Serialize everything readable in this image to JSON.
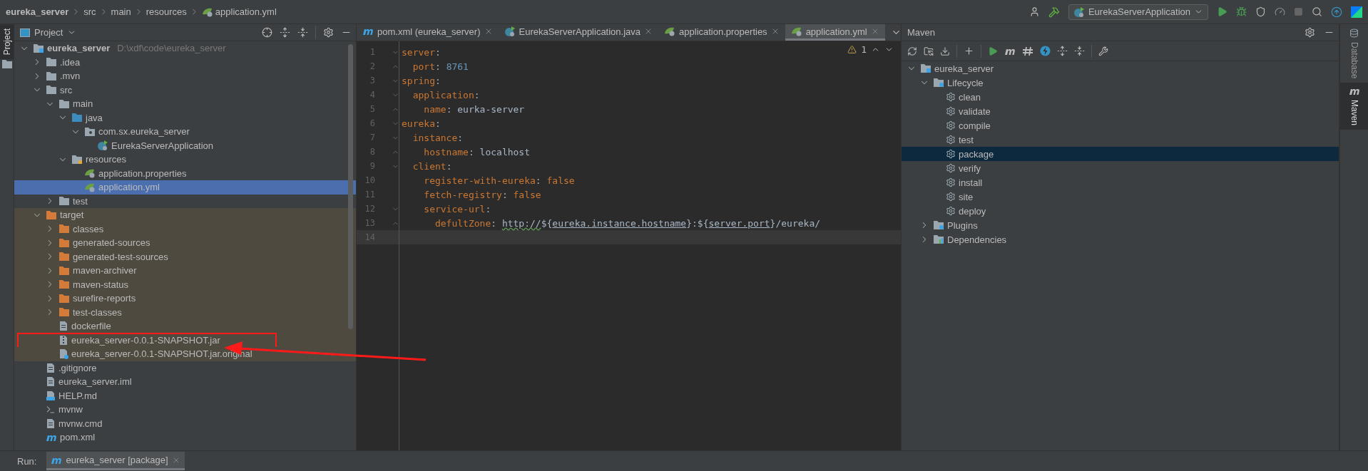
{
  "breadcrumb": [
    {
      "text": "eureka_server",
      "kind": "project"
    },
    {
      "text": "src",
      "kind": "plain"
    },
    {
      "text": "main",
      "kind": "plain"
    },
    {
      "text": "resources",
      "kind": "plain"
    },
    {
      "text": "application.yml",
      "kind": "config"
    }
  ],
  "run_config": "EurekaServerApplication",
  "left_strip": [
    {
      "label": "Project",
      "selected": true
    }
  ],
  "project_panel": {
    "title": "Project",
    "tree": [
      {
        "name": "eureka_server",
        "path": "D:\\xdf\\code\\eureka_server",
        "kind": "module",
        "expanded": true,
        "selected": false,
        "children": [
          {
            "name": ".idea",
            "kind": "folder",
            "expanded": false,
            "selected": false,
            "excluded": false
          },
          {
            "name": ".mvn",
            "kind": "folder",
            "expanded": false,
            "selected": false,
            "excluded": false
          },
          {
            "name": "src",
            "kind": "folder",
            "expanded": true,
            "selected": false,
            "excluded": false,
            "children": [
              {
                "name": "main",
                "kind": "folder",
                "expanded": true,
                "selected": false,
                "children": [
                  {
                    "name": "java",
                    "kind": "source-folder",
                    "expanded": true,
                    "selected": false,
                    "children": [
                      {
                        "name": "com.sx.eureka_server",
                        "kind": "package",
                        "expanded": true,
                        "selected": false,
                        "children": [
                          {
                            "name": "EurekaServerApplication",
                            "kind": "class",
                            "selected": false
                          }
                        ]
                      }
                    ]
                  },
                  {
                    "name": "resources",
                    "kind": "resource-folder",
                    "expanded": true,
                    "selected": false,
                    "children": [
                      {
                        "name": "application.properties",
                        "kind": "config",
                        "selected": false
                      },
                      {
                        "name": "application.yml",
                        "kind": "config",
                        "selected": true
                      }
                    ]
                  }
                ]
              },
              {
                "name": "test",
                "kind": "folder",
                "expanded": false,
                "selected": false
              }
            ]
          },
          {
            "name": "target",
            "kind": "excluded-folder",
            "expanded": true,
            "selected": false,
            "excluded": true,
            "children": [
              {
                "name": "classes",
                "kind": "excluded-folder",
                "expanded": false,
                "selected": false,
                "highlighted": false
              },
              {
                "name": "generated-sources",
                "kind": "excluded-folder",
                "expanded": false,
                "selected": false,
                "highlighted": false
              },
              {
                "name": "generated-test-sources",
                "kind": "excluded-folder",
                "expanded": false,
                "selected": false,
                "highlighted": false
              },
              {
                "name": "maven-archiver",
                "kind": "excluded-folder",
                "expanded": false,
                "selected": false,
                "highlighted": false
              },
              {
                "name": "maven-status",
                "kind": "excluded-folder",
                "expanded": false,
                "selected": false,
                "highlighted": false
              },
              {
                "name": "surefire-reports",
                "kind": "excluded-folder",
                "expanded": false,
                "selected": false,
                "highlighted": false
              },
              {
                "name": "test-classes",
                "kind": "excluded-folder",
                "expanded": false,
                "selected": false,
                "highlighted": false
              },
              {
                "name": "dockerfile",
                "kind": "file",
                "selected": false,
                "highlighted": false
              },
              {
                "name": "eureka_server-0.0.1-SNAPSHOT.jar",
                "kind": "archive",
                "selected": false,
                "highlighted": true
              },
              {
                "name": "eureka_server-0.0.1-SNAPSHOT.jar.original",
                "kind": "unknown-file",
                "selected": false,
                "highlighted": false
              }
            ]
          },
          {
            "name": ".gitignore",
            "kind": "file",
            "selected": false,
            "excluded": false
          },
          {
            "name": "eureka_server.iml",
            "kind": "file",
            "selected": false,
            "excluded": false
          },
          {
            "name": "HELP.md",
            "kind": "markdown",
            "selected": false,
            "excluded": false
          },
          {
            "name": "mvnw",
            "kind": "script",
            "selected": false,
            "excluded": false
          },
          {
            "name": "mvnw.cmd",
            "kind": "file",
            "selected": false,
            "excluded": false
          },
          {
            "name": "pom.xml",
            "kind": "maven",
            "selected": false,
            "excluded": false
          }
        ]
      }
    ]
  },
  "editor": {
    "tabs": [
      {
        "label": "pom.xml (eureka_server)",
        "kind": "maven",
        "selected": false
      },
      {
        "label": "EurekaServerApplication.java",
        "kind": "class",
        "selected": false
      },
      {
        "label": "application.properties",
        "kind": "config",
        "selected": false
      },
      {
        "label": "application.yml",
        "kind": "config",
        "selected": true
      }
    ],
    "warning_count": "1",
    "lines": [
      {
        "number": "1",
        "fold_start": true,
        "fold_end": false,
        "current": false,
        "tokens": [
          {
            "kind": "key",
            "text": "server"
          },
          {
            "kind": "plain",
            "text": ":"
          }
        ]
      },
      {
        "number": "2",
        "fold_start": false,
        "fold_end": true,
        "current": false,
        "tokens": [
          {
            "kind": "key",
            "text": "  port"
          },
          {
            "kind": "plain",
            "text": ": "
          },
          {
            "kind": "number",
            "text": "8761"
          }
        ]
      },
      {
        "number": "3",
        "fold_start": true,
        "fold_end": false,
        "current": false,
        "tokens": [
          {
            "kind": "key",
            "text": "spring"
          },
          {
            "kind": "plain",
            "text": ":"
          }
        ]
      },
      {
        "number": "4",
        "fold_start": true,
        "fold_end": false,
        "current": false,
        "tokens": [
          {
            "kind": "key",
            "text": "  application"
          },
          {
            "kind": "plain",
            "text": ":"
          }
        ]
      },
      {
        "number": "5",
        "fold_start": false,
        "fold_end": true,
        "current": false,
        "tokens": [
          {
            "kind": "key",
            "text": "    name"
          },
          {
            "kind": "plain",
            "text": ": eurka-server"
          }
        ]
      },
      {
        "number": "6",
        "fold_start": true,
        "fold_end": false,
        "current": false,
        "tokens": [
          {
            "kind": "key",
            "text": "eureka"
          },
          {
            "kind": "plain",
            "text": ":"
          }
        ]
      },
      {
        "number": "7",
        "fold_start": true,
        "fold_end": false,
        "current": false,
        "tokens": [
          {
            "kind": "key",
            "text": "  instance"
          },
          {
            "kind": "plain",
            "text": ":"
          }
        ]
      },
      {
        "number": "8",
        "fold_start": false,
        "fold_end": true,
        "current": false,
        "tokens": [
          {
            "kind": "key",
            "text": "    hostname"
          },
          {
            "kind": "plain",
            "text": ": localhost"
          }
        ]
      },
      {
        "number": "9",
        "fold_start": true,
        "fold_end": false,
        "current": false,
        "tokens": [
          {
            "kind": "key",
            "text": "  client"
          },
          {
            "kind": "plain",
            "text": ":"
          }
        ]
      },
      {
        "number": "10",
        "fold_start": false,
        "fold_end": false,
        "current": false,
        "tokens": [
          {
            "kind": "key",
            "text": "    register-with-eureka"
          },
          {
            "kind": "plain",
            "text": ": "
          },
          {
            "kind": "keyword",
            "text": "false"
          }
        ]
      },
      {
        "number": "11",
        "fold_start": false,
        "fold_end": false,
        "current": false,
        "tokens": [
          {
            "kind": "key",
            "text": "    fetch-registry"
          },
          {
            "kind": "plain",
            "text": ": "
          },
          {
            "kind": "keyword",
            "text": "false"
          }
        ]
      },
      {
        "number": "12",
        "fold_start": true,
        "fold_end": false,
        "current": false,
        "tokens": [
          {
            "kind": "key",
            "text": "    service-url"
          },
          {
            "kind": "plain",
            "text": ":"
          }
        ]
      },
      {
        "number": "13",
        "fold_start": false,
        "fold_end": true,
        "current": false,
        "tokens": [
          {
            "kind": "key",
            "text": "      defultZone"
          },
          {
            "kind": "plain",
            "text": ": "
          },
          {
            "kind": "typo",
            "text": "http://"
          },
          {
            "kind": "plain",
            "text": "${"
          },
          {
            "kind": "ref",
            "text": "eureka.instance.hostname"
          },
          {
            "kind": "plain",
            "text": "}:${"
          },
          {
            "kind": "ref",
            "text": "server.port"
          },
          {
            "kind": "plain",
            "text": "}/eureka/"
          }
        ]
      },
      {
        "number": "14",
        "fold_start": false,
        "fold_end": false,
        "current": true
      }
    ]
  },
  "maven_panel": {
    "title": "Maven",
    "tree": [
      {
        "name": "eureka_server",
        "kind": "project",
        "expanded": true,
        "selected": false,
        "children": [
          {
            "name": "Lifecycle",
            "kind": "category",
            "expanded": true,
            "selected": false,
            "children": [
              {
                "name": "clean",
                "kind": "goal",
                "selected": false
              },
              {
                "name": "validate",
                "kind": "goal",
                "selected": false
              },
              {
                "name": "compile",
                "kind": "goal",
                "selected": false
              },
              {
                "name": "test",
                "kind": "goal",
                "selected": false
              },
              {
                "name": "package",
                "kind": "goal",
                "selected": true
              },
              {
                "name": "verify",
                "kind": "goal",
                "selected": false
              },
              {
                "name": "install",
                "kind": "goal",
                "selected": false
              },
              {
                "name": "site",
                "kind": "goal",
                "selected": false
              },
              {
                "name": "deploy",
                "kind": "goal",
                "selected": false
              }
            ]
          },
          {
            "name": "Plugins",
            "kind": "category",
            "expanded": false,
            "selected": false
          },
          {
            "name": "Dependencies",
            "kind": "dependencies",
            "expanded": false,
            "selected": false
          }
        ]
      }
    ]
  },
  "right_strip": [
    {
      "label": "Database",
      "kind": "database",
      "selected": false
    },
    {
      "label": "Maven",
      "kind": "maven",
      "selected": true
    }
  ],
  "run_bar": {
    "label": "Run:",
    "tabs": [
      {
        "label": "eureka_server [package]",
        "selected": true
      }
    ]
  },
  "annotation": {
    "kind": "arrow"
  }
}
